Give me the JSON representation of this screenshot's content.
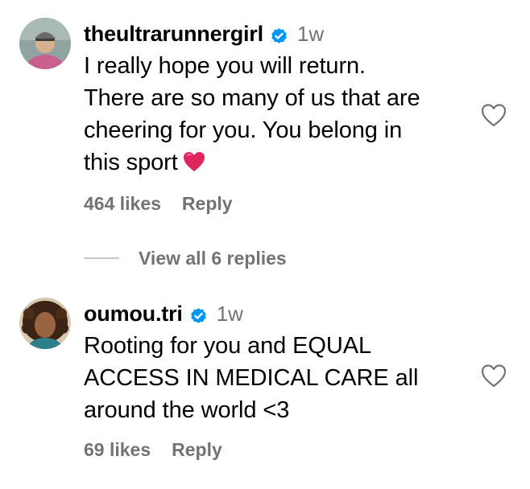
{
  "comments": [
    {
      "username": "theultrarunnergirl",
      "time": "1w",
      "lines": [
        "I really hope you will return.",
        "There are so many of us that are",
        "cheering for you. You belong in",
        "this sport"
      ],
      "likes": "464 likes",
      "reply": "Reply"
    },
    {
      "username": "oumou.tri",
      "time": "1w",
      "lines": [
        "Rooting for you and EQUAL",
        "ACCESS IN MEDICAL CARE all",
        "around the world <3"
      ],
      "likes": "69 likes",
      "reply": "Reply"
    }
  ],
  "view_replies": "View all 6 replies",
  "colors": {
    "verified": "#0095f6",
    "secondary_text": "#737373",
    "heart_emoji": "#e0245e",
    "divider": "#c7c7c7"
  },
  "icons": {
    "verified": "verified-badge-icon",
    "like": "heart-outline-icon",
    "emoji": "red-heart-emoji-icon"
  }
}
